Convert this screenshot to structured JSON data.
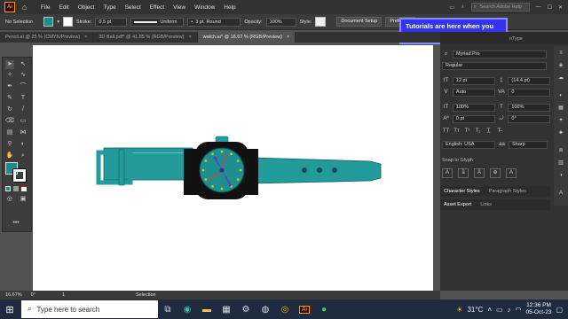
{
  "app": {
    "logo": "Ai",
    "icons": {
      "home": "home-icon",
      "search": "search-icon"
    }
  },
  "menu": [
    "File",
    "Edit",
    "Object",
    "Type",
    "Select",
    "Effect",
    "View",
    "Window",
    "Help"
  ],
  "help_search_placeholder": "Search Adobe Help",
  "control": {
    "selection_label": "No Selection",
    "stroke_label": "Stroke:",
    "stroke_value": "0.5 pt",
    "stroke_profile": "Uniform",
    "brush": "3 pt. Round",
    "opacity_label": "Opacity:",
    "opacity_value": "100%",
    "style_label": "Style:",
    "document_setup": "Document Setup",
    "preferences": "Preferenc",
    "fill_color": "#1b8c8c"
  },
  "tabs": [
    {
      "label": "Pencil.ai @ 25 % (CMYK/Preview)",
      "active": false
    },
    {
      "label": "3D Ball.pdf* @ 41.85 % (RGB/Preview)",
      "active": false
    },
    {
      "label": "watch.ai* @ 16.67 % (RGB/Preview)",
      "active": true
    }
  ],
  "tab_close": "×",
  "tutorial_popup": "Tutorials are here when you need them.",
  "right_panel": {
    "tab_fragment": "nType",
    "font_family": "Myriad Pro",
    "font_style": "Regular",
    "font_size": "12 pt",
    "leading": "(14.4 pt)",
    "kerning": "Auto",
    "tracking": "0",
    "vertical_scale": "100%",
    "horizontal_scale": "100%",
    "baseline_shift": "0 pt",
    "rotation": "0°",
    "language": "English: USA",
    "antialias": "Sharp",
    "snap_to_glyph": "Snap to Glyph",
    "character_styles": "Character Styles",
    "paragraph_styles": "Paragraph Styles",
    "asset_export": "Asset Export",
    "links": "Links"
  },
  "status": {
    "zoom": "16.67%",
    "rotation": "0°",
    "artboard": "1",
    "mode": "Selection"
  },
  "watch": {
    "strap_color": "#239b9b",
    "case_color": "#111111",
    "dial_color": "#1d8f8f",
    "hand_color": "#5a3fc4"
  },
  "taskbar": {
    "search_placeholder": "Type here to search",
    "temperature": "31°C",
    "time": "12:36 PM",
    "date": "05-Oct-23",
    "icons": [
      "task-view-icon",
      "edge-icon",
      "file-explorer-icon",
      "store-icon",
      "settings-icon",
      "steam-icon",
      "chrome-icon",
      "illustrator-icon",
      "whatsapp-icon"
    ]
  }
}
